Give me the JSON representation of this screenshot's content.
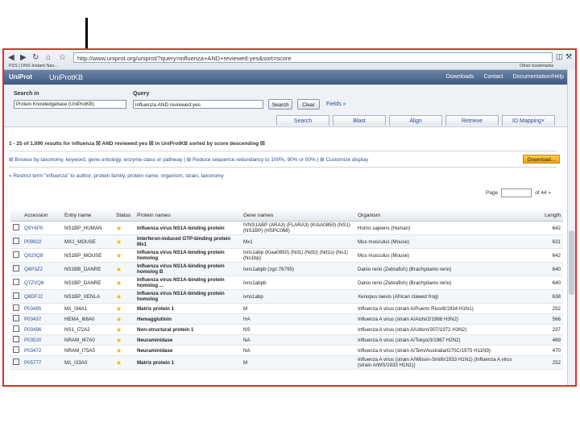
{
  "browser": {
    "url": "http://www.uniprot.org/uniprot/?query=influenza+AND+reviewed:yes&sort=score",
    "bookmarks": [
      "PZS | DNS Instant Nav..."
    ],
    "other_bookmarks": "Other bookmarks"
  },
  "header": {
    "logo": "UniProt",
    "db": "UniProtKB",
    "links": [
      "Downloads",
      "Contact",
      "Documentation/Help"
    ]
  },
  "search": {
    "search_in_label": "Search in",
    "search_in_value": "Protein Knowledgebase (UniProtKB)",
    "query_label": "Query",
    "query_value": "influenza AND reviewed:yes",
    "search_btn": "Search",
    "clear_btn": "Clear",
    "fields": "Fields »"
  },
  "tabs": [
    "Search",
    "Blast",
    "Align",
    "Retrieve",
    "ID Mapping˅"
  ],
  "results_text": "1 - 25 of 1,090 results for influenza ☒ AND reviewed:yes ☒ in UniProtKB sorted by score descending ☒",
  "tools_text": "⊞ Browse by taxonomy, keyword, gene ontology, enzyme class or pathway | ⊞ Reduce sequence redundancy to 100%, 90% or 50% | ⊞ Customize display",
  "download": "Download...",
  "restrict": "» Restrict term \"influenza\" to author, protein family, protein name, organism, strain, taxonomy",
  "pager": {
    "page_label": "Page",
    "of": "of 44 »"
  },
  "columns": [
    "Accession",
    "Entry name",
    "Status",
    "Protein names",
    "Gene names",
    "Organism",
    "Length"
  ],
  "rows": [
    {
      "acc": "Q9Y6P0",
      "entry": "NS1BP_HUMAN",
      "protein": "Influenza virus NS1A-binding protein",
      "gene": "IVNS1ABP (ARA3) (FLARA3) (KIAA0850) (NS1) (NS1BP) (HSPC068)",
      "org": "Homo sapiens (Human)",
      "len": "642"
    },
    {
      "acc": "P09922",
      "entry": "MX1_MOUSE",
      "protein": "Interferon-induced GTP-binding protein Mx1",
      "gene": "Mx1",
      "org": "Mus musculus (Mouse)",
      "len": "631"
    },
    {
      "acc": "Q920Q8",
      "entry": "NS1BP_MOUSE",
      "protein": "Influenza virus NS1A-binding protein homolog",
      "gene": "Ivns1abp (Kiaa0850) (Nd1) (Nd1l) (Nd1s) (Ns1) (Ns1bp)",
      "org": "Mus musculus (Mouse)",
      "len": "642"
    },
    {
      "acc": "Q6P3Z2",
      "entry": "NS1BB_DANRE",
      "protein": "Influenza virus NS1A-binding protein homolog B",
      "gene": "Ivns1abpb (zgc:76795)",
      "org": "Danio rerio (Zebrafish) (Brachydanio rerio)",
      "len": "640"
    },
    {
      "acc": "Q7ZVQ8",
      "entry": "NS1BP_DANRE",
      "protein": "Influenza virus NS1A-binding protein homolog ...",
      "gene": "Ivns1abpb",
      "org": "Danio rerio (Zebrafish) (Brachydanio rerio)",
      "len": "640"
    },
    {
      "acc": "Q6DFJ2",
      "entry": "NS1BP_XENLA",
      "protein": "Influenza virus NS1A-binding protein homolog",
      "gene": "ivns1abp",
      "org": "Xenopus laevis (African clawed frog)",
      "len": "638"
    },
    {
      "acc": "P03485",
      "entry": "M1_I34A1",
      "protein": "Matrix protein 1",
      "gene": "M",
      "org": "Influenza A virus (strain A/Puerto Rico/8/1934 H1N1)",
      "len": "252"
    },
    {
      "acc": "P03437",
      "entry": "HEMA_I68A0",
      "protein": "Hemagglutinin",
      "gene": "HA",
      "org": "Influenza A virus (strain A/Aichi/2/1968 H3N2)",
      "len": "566"
    },
    {
      "acc": "P03496",
      "entry": "NS1_I72A2",
      "protein": "Non-structural protein 1",
      "gene": "NS",
      "org": "Influenza A virus (strain A/Udorn/307/1972 H3N2)",
      "len": "237"
    },
    {
      "acc": "P03520",
      "entry": "NRAM_I67A0",
      "protein": "Neuraminidase",
      "gene": "NA",
      "org": "Influenza A virus (strain A/Tokyo/3/1967 H2N2)",
      "len": "469"
    },
    {
      "acc": "P03472",
      "entry": "NRAM_I75A5",
      "protein": "Neuraminidase",
      "gene": "NA",
      "org": "Influenza A virus (strain A/Tern/Australia/G70C/1975 H11N9)",
      "len": "470"
    },
    {
      "acc": "P05777",
      "entry": "M1_I33A0",
      "protein": "Matrix protein 1",
      "gene": "M",
      "org": "Influenza A virus (strain A/Wilson-Smith/1933 H1N1) (Influenza A virus (strain A/WS/1933 H1N1))",
      "len": "252"
    }
  ]
}
